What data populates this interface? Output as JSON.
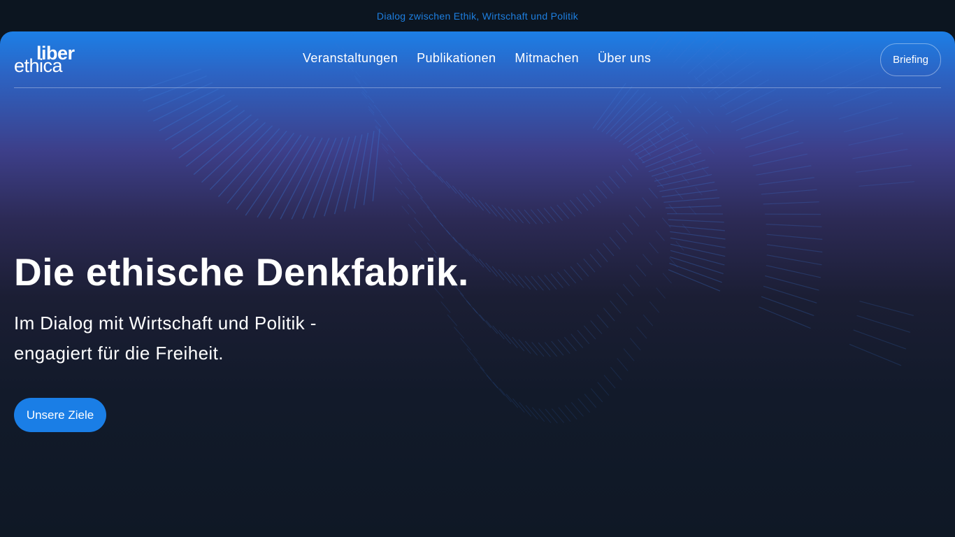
{
  "topbar": {
    "tagline": "Dialog zwischen Ethik, Wirtschaft und Politik"
  },
  "logo": {
    "line1": "liber",
    "line2": "ethica"
  },
  "nav": {
    "items": [
      {
        "label": "Veranstaltungen"
      },
      {
        "label": "Publikationen"
      },
      {
        "label": "Mitmachen"
      },
      {
        "label": "Über uns"
      }
    ],
    "briefing_label": "Briefing"
  },
  "hero": {
    "headline": "Die ethische Denkfabrik.",
    "subline": "Im Dialog mit Wirtschaft und Politik - engagiert für die Freiheit.",
    "cta_label": "Unsere Ziele"
  },
  "colors": {
    "accent": "#1a7ee6",
    "page_background": "#0c1520",
    "line_art": "#3a78d8"
  }
}
